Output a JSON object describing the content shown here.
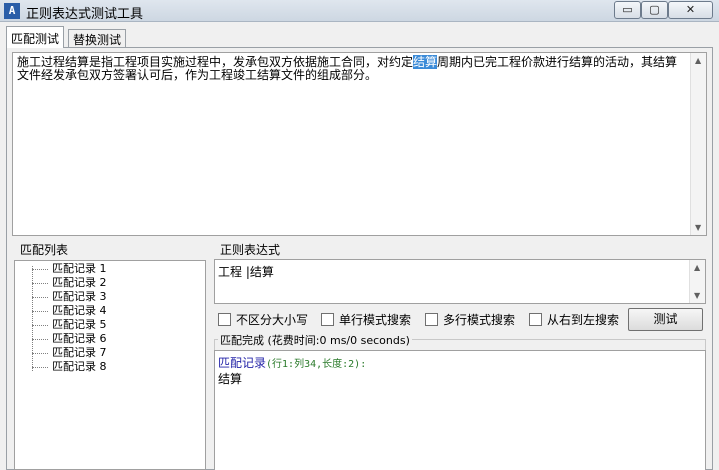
{
  "window": {
    "title": "正则表达式测试工具",
    "icon": "regex-app-icon",
    "buttons": {
      "minimize": "▭",
      "maximize": "▢",
      "close": "✕"
    }
  },
  "tabs": [
    {
      "label": "匹配测试",
      "active": true
    },
    {
      "label": "替换测试",
      "active": false
    }
  ],
  "source_text": {
    "before": "施工过程结算是指工程项目实施过程中，发承包双方依据施工合同，对约定",
    "highlight": "结算",
    "after": "周期内已完工程价款进行结算的活动，其结算文件经发承包双方签署认可后，作为工程竣工结算文件的组成部分。"
  },
  "match_list": {
    "label": "匹配列表",
    "items": [
      "匹配记录 1",
      "匹配记录 2",
      "匹配记录 3",
      "匹配记录 4",
      "匹配记录 5",
      "匹配记录 6",
      "匹配记录 7",
      "匹配记录 8"
    ]
  },
  "regex": {
    "label": "正则表达式",
    "value": "工程 |结算"
  },
  "options": [
    {
      "label": "不区分大小写",
      "checked": false
    },
    {
      "label": "单行模式搜索",
      "checked": false
    },
    {
      "label": "多行模式搜索",
      "checked": false
    },
    {
      "label": "从右到左搜索",
      "checked": false
    }
  ],
  "test_button": "测试",
  "result": {
    "legend": "匹配完成 (花费时间:0 ms/0 seconds)",
    "title": "匹配记录",
    "meta": "(行1:列34,长度:2):",
    "value": "结算"
  }
}
